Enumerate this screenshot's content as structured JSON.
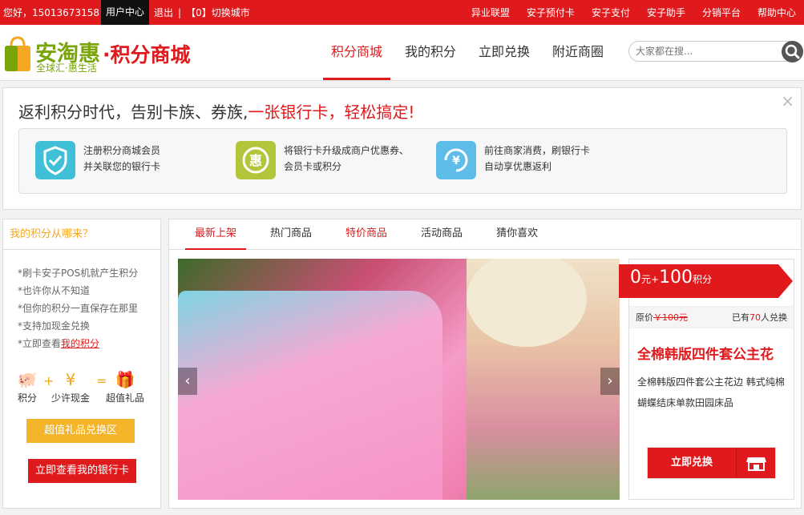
{
  "topbar": {
    "greeting": "您好，15013673158",
    "user_center": "用户中心",
    "logout": "退出",
    "city": "【0】切换城市",
    "links": [
      "异业联盟",
      "安子预付卡",
      "安子支付",
      "安子助手",
      "分销平台",
      "帮助中心"
    ]
  },
  "logo": {
    "brand": "安淘惠",
    "suffix": "·积分商城",
    "slogan": "全球汇·惠生活"
  },
  "nav": {
    "items": [
      "积分商城",
      "我的积分",
      "立即兑换",
      "附近商圈"
    ]
  },
  "search": {
    "placeholder": "大家都在搜..."
  },
  "banner": {
    "title_prefix": "返利积分时代，告别卡族、券族,",
    "title_highlight": "一张银行卡，轻松搞定!",
    "close": "×",
    "steps": [
      {
        "line1": "注册积分商城会员",
        "line2": "并关联您的银行卡"
      },
      {
        "line1": "将银行卡升级成商户优惠券、",
        "line2": "会员卡或积分"
      },
      {
        "line1": "前往商家消费，刷银行卡",
        "line2": "自动享优惠返利"
      }
    ]
  },
  "sidebar": {
    "header": "我的积分从哪来？",
    "tips": [
      "*刷卡安子POS机就产生积分",
      "*也许你从不知道",
      "*但你的积分一直保存在那里",
      "*支持加现金兑换"
    ],
    "last_tip_prefix": "*立即查看",
    "last_tip_link": "我的积分",
    "eq_points": "积分",
    "eq_cash": "少许现金",
    "eq_gift": "超值礼品",
    "btn_gift": "超值礼品兑换区",
    "btn_card": "立即查看我的银行卡"
  },
  "tabs": [
    "最新上架",
    "热门商品",
    "特价商品",
    "活动商品",
    "猜你喜欢"
  ],
  "product": {
    "price_cash": "0",
    "price_cash_unit": "元+",
    "price_points": "100",
    "price_points_unit": "积分",
    "orig_label": "原价",
    "orig_price": "￥100元",
    "sold_prefix": "已有",
    "sold_count": "70",
    "sold_suffix": "人兑换",
    "title": "全棉韩版四件套公主花",
    "desc": "全棉韩版四件套公主花边 韩式纯棉蝴蝶结床单款田园床品",
    "exchange_btn": "立即兑换"
  }
}
